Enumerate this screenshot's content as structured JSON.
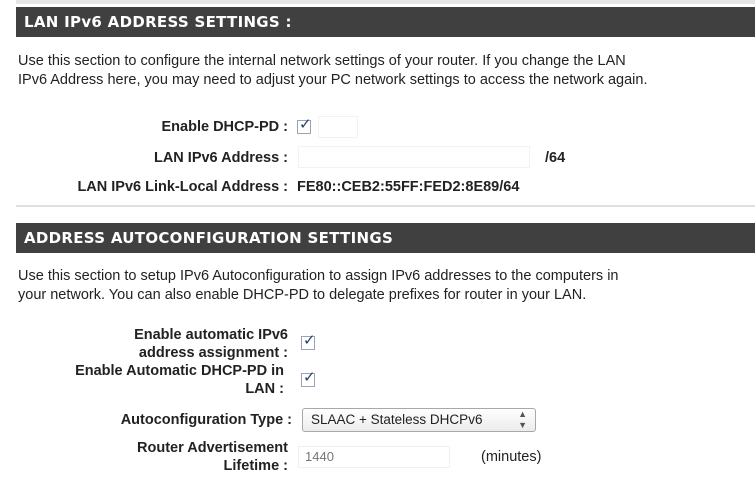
{
  "lan_section": {
    "title": "LAN IPv6 ADDRESS SETTINGS :",
    "description_line1": "Use this section to configure the internal network settings of your router. If you change the LAN",
    "description_line2": "IPv6 Address here, you may need to adjust your PC network settings to access the network again.",
    "enable_dhcp_pd_label": "Enable DHCP-PD :",
    "enable_dhcp_pd_checked": true,
    "lan_ipv6_address_label": "LAN IPv6 Address :",
    "lan_ipv6_address_value": "",
    "lan_ipv6_prefix_suffix": "/64",
    "link_local_label": "LAN IPv6 Link-Local Address :",
    "link_local_value": "FE80::CEB2:55FF:FED2:8E89/64"
  },
  "autoconfig_section": {
    "title": "ADDRESS AUTOCONFIGURATION SETTINGS",
    "description_line1": "Use this section to setup IPv6 Autoconfiguration to assign IPv6 addresses to the computers in",
    "description_line2": "your network. You can also enable DHCP-PD to delegate prefixes for router in your LAN.",
    "enable_auto_assign_label_1": "Enable automatic IPv6",
    "enable_auto_assign_label_2": "address assignment :",
    "enable_auto_assign_checked": true,
    "enable_auto_dhcp_pd_label_1": "Enable Automatic DHCP-PD in",
    "enable_auto_dhcp_pd_label_2": "LAN :",
    "enable_auto_dhcp_pd_checked": true,
    "autoconfig_type_label": "Autoconfiguration Type :",
    "autoconfig_type_value": "SLAAC + Stateless DHCPv6",
    "ra_lifetime_label_1": "Router Advertisement",
    "ra_lifetime_label_2": "Lifetime :",
    "ra_lifetime_value": "1440",
    "ra_lifetime_unit": "(minutes)"
  },
  "colors": {
    "header_bg": "#404040",
    "header_text": "#ffffff",
    "checkmark": "#2b3e6b"
  }
}
